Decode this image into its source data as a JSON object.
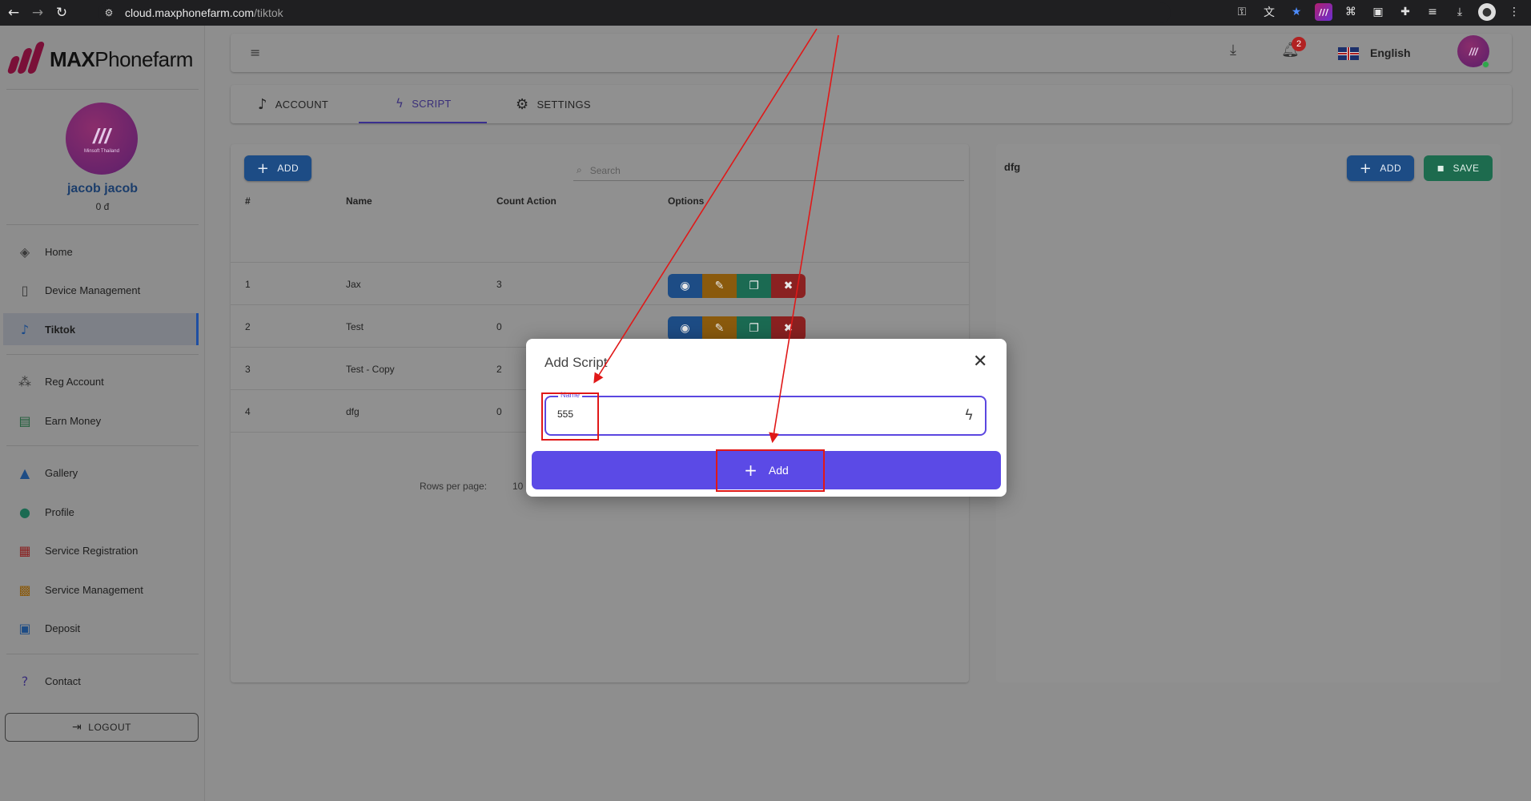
{
  "browser": {
    "url_host": "cloud.maxphonefarm.com",
    "url_path": "/tiktok"
  },
  "brand": {
    "name_bold": "MAX",
    "name_light": "Phonefarm"
  },
  "user": {
    "name": "jacob jacob",
    "balance": "0 đ",
    "avatar_text": "Minsoft Thailand"
  },
  "sidebar": {
    "items": [
      {
        "label": "Home",
        "icon": "layers-icon"
      },
      {
        "label": "Device Management",
        "icon": "device-icon"
      },
      {
        "label": "Tiktok",
        "icon": "tiktok-icon"
      },
      {
        "label": "Reg Account",
        "icon": "reg-account-icon"
      },
      {
        "label": "Earn Money",
        "icon": "money-icon"
      },
      {
        "label": "Gallery",
        "icon": "image-icon"
      },
      {
        "label": "Profile",
        "icon": "person-icon"
      },
      {
        "label": "Service Registration",
        "icon": "apps-icon"
      },
      {
        "label": "Service Management",
        "icon": "manage-icon"
      },
      {
        "label": "Deposit",
        "icon": "wallet-icon"
      },
      {
        "label": "Contact",
        "icon": "help-icon"
      }
    ],
    "logout": "LOGOUT"
  },
  "header": {
    "language": "English",
    "notification_count": "2"
  },
  "tabs": [
    {
      "label": "ACCOUNT"
    },
    {
      "label": "SCRIPT"
    },
    {
      "label": "SETTINGS"
    }
  ],
  "left_card": {
    "add_label": "ADD",
    "search_placeholder": "Search",
    "columns": [
      "#",
      "Name",
      "Count Action",
      "Options"
    ],
    "rows": [
      {
        "num": "1",
        "name": "Jax",
        "count": "3"
      },
      {
        "num": "2",
        "name": "Test",
        "count": "0"
      },
      {
        "num": "3",
        "name": "Test - Copy",
        "count": "2"
      },
      {
        "num": "4",
        "name": "dfg",
        "count": "0"
      }
    ],
    "rows_per_page_label": "Rows per page:",
    "rows_per_page_value": "10"
  },
  "right_card": {
    "title": "dfg",
    "add_label": "ADD",
    "save_label": "SAVE"
  },
  "modal": {
    "title": "Add Script",
    "field_label": "Name",
    "field_value": "555",
    "add_label": "Add"
  },
  "colors": {
    "accent": "#5b4ae6",
    "annotation": "#e01818"
  }
}
